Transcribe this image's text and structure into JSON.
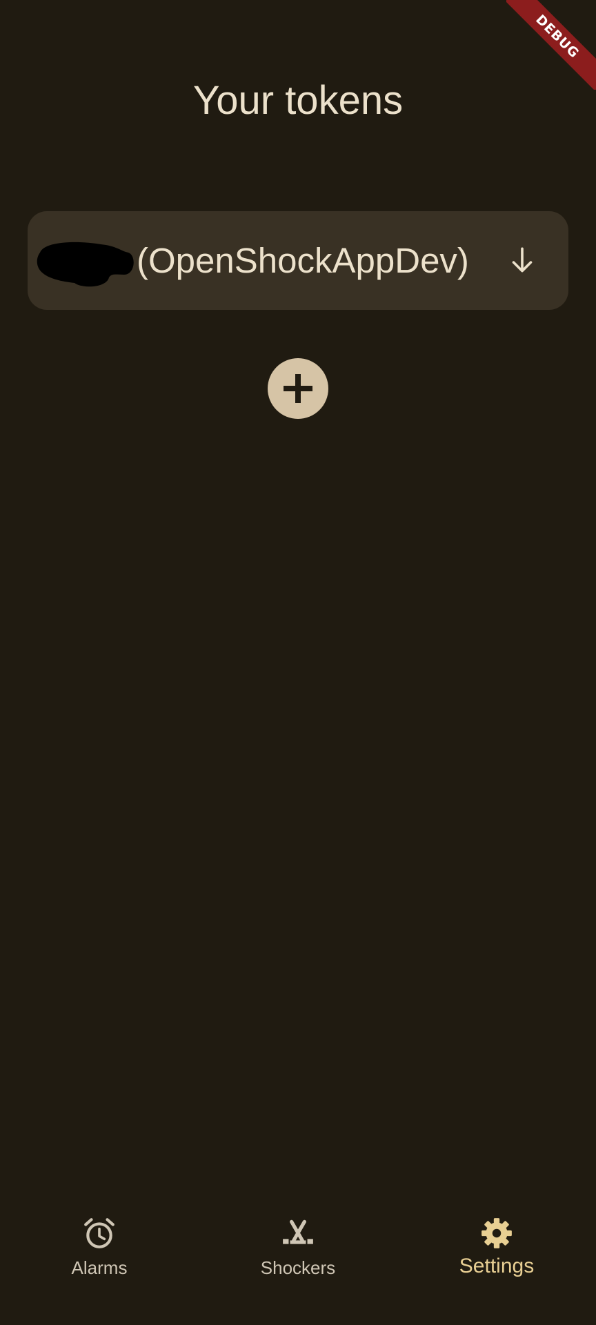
{
  "debug_banner": {
    "label": "DEBUG"
  },
  "page": {
    "title": "Your tokens"
  },
  "tokens": [
    {
      "label": "(OpenShockAppDev)",
      "expand_icon": "arrow-down-icon"
    }
  ],
  "add_button": {
    "icon": "plus-icon"
  },
  "bottom_nav": {
    "items": [
      {
        "label": "Alarms",
        "icon": "alarm-clock-icon",
        "active": false
      },
      {
        "label": "Shockers",
        "icon": "shocker-icon",
        "active": false
      },
      {
        "label": "Settings",
        "icon": "gear-icon",
        "active": true
      }
    ]
  },
  "colors": {
    "background": "#201b11",
    "card": "#393124",
    "text": "#ece1cb",
    "accent": "#e8cf93",
    "add_button": "#d6c4a6",
    "debug": "#8c1d1d"
  }
}
